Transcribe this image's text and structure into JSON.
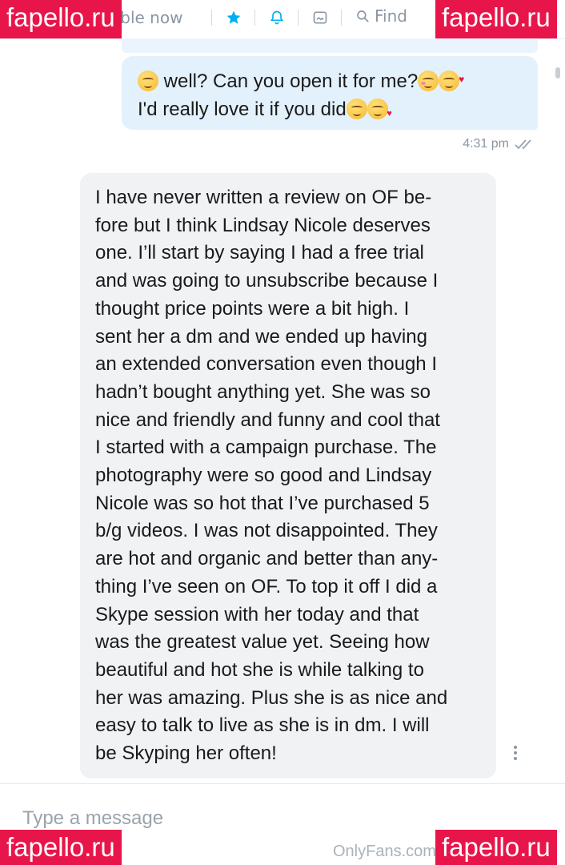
{
  "topbar": {
    "status_text": "able now",
    "find_label": "Find"
  },
  "watermarks": {
    "top_left": "fapello.ru",
    "top_right": "fapello.ru",
    "bottom_left": "fapello.ru",
    "bottom_right": "fapello.ru"
  },
  "outgoing": {
    "line1": "well? Can you open it for me?",
    "line2": "I'd really love it if you did",
    "time": "4:31 pm"
  },
  "incoming": {
    "lines": [
      "I have never written a review on OF be-",
      "fore but I think Lindsay Nicole deserves",
      "one. I’ll start by saying I had a free trial",
      "and was going to unsubscribe because I",
      "thought price points were a bit high. I",
      "sent her a dm and we ended up having",
      "an extended conversation even though I",
      "hadn’t bought anything yet. She was so",
      "nice and friendly and funny and cool that",
      "I started with a campaign purchase. The",
      "photography were so good and Lindsay",
      "Nicole was so hot that I’ve purchased 5",
      "b/g videos. I was not disappointed. They",
      "are hot and organic and better than any-",
      "thing I’ve seen on OF. To top it off I did a",
      "Skype session with her today and that",
      "was the greatest value yet. Seeing how",
      "beautiful and hot she is while talking to",
      "her was amazing. Plus she is as nice and",
      "easy to talk to live as she is in dm. I will",
      "be Skyping her often!"
    ]
  },
  "composer": {
    "placeholder": "Type a message"
  },
  "footer": {
    "text": "OnlyFans.com"
  },
  "colors": {
    "accent": "#00aff0",
    "watermark": "#e8154a",
    "outgoing_bubble": "#e3f1fc",
    "incoming_bubble": "#f0f2f4",
    "muted": "#8a96a3"
  },
  "icons": [
    "star-icon",
    "bell-icon",
    "image-icon",
    "search-icon",
    "double-check-icon",
    "more-vertical-icon"
  ]
}
